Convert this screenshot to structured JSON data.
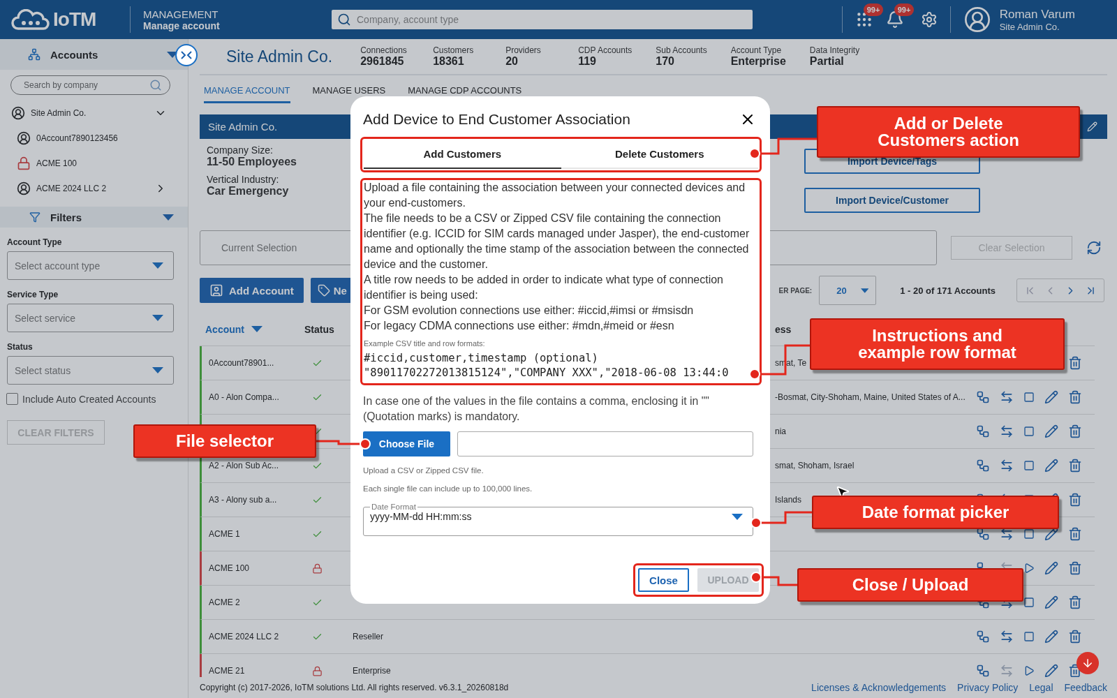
{
  "header": {
    "logo": "IoTM",
    "section": "MANAGEMENT",
    "subsection": "Manage account",
    "search": {
      "placeholder": "Company, account type"
    },
    "badges": [
      "99+",
      "99+"
    ],
    "user": {
      "name": "Roman Varum",
      "company": "Site Admin Co."
    }
  },
  "sidebar": {
    "title": "Accounts",
    "search": {
      "placeholder": "Search by company"
    },
    "tree": [
      {
        "label": "Site Admin Co.",
        "locked": false,
        "expanded": true,
        "children": [
          {
            "label": "0Account7890123456",
            "locked": false
          },
          {
            "label": "ACME 100",
            "locked": true
          },
          {
            "label": "ACME 2024 LLC 2",
            "locked": false,
            "expanded": false
          }
        ]
      }
    ],
    "filters": {
      "title": "Filters",
      "fields": [
        {
          "label": "Account Type",
          "placeholder": "Select account type"
        },
        {
          "label": "Service Type",
          "placeholder": "Select service"
        },
        {
          "label": "Status",
          "placeholder": "Select status"
        }
      ],
      "checkbox": {
        "label": "Include Auto Created Accounts",
        "checked": false
      },
      "clear_button": {
        "label": "CLEAR FILTERS",
        "disabled": true
      }
    }
  },
  "account_header": {
    "title": "Site Admin Co.",
    "stats": [
      {
        "label": "Connections",
        "value": "2961845"
      },
      {
        "label": "Customers",
        "value": "18361"
      },
      {
        "label": "Providers",
        "value": "20"
      },
      {
        "label": "CDP Accounts",
        "value": "119"
      },
      {
        "label": "Sub Accounts",
        "value": "170"
      },
      {
        "label": "Account Type",
        "value": "Enterprise"
      },
      {
        "label": "Data Integrity",
        "value": "Partial"
      }
    ]
  },
  "tabs": [
    {
      "label": "MANAGE ACCOUNT",
      "selected": true
    },
    {
      "label": "MANAGE USERS",
      "selected": false
    },
    {
      "label": "MANAGE CDP ACCOUNTS",
      "selected": false
    }
  ],
  "company_card": {
    "title": "Site Admin Co.",
    "details": [
      {
        "label": "Company Size:",
        "value": "11-50 Employees"
      },
      {
        "label": "Vertical Industry:",
        "value": "Car Emergency"
      }
    ],
    "buttons": [
      "Import Device/Tags",
      "Import Device/Customer"
    ]
  },
  "selection": {
    "placeholder": "Current Selection",
    "clear_button": {
      "label": "Clear Selection",
      "disabled": true
    }
  },
  "toolbar": {
    "buttons": [
      "Add Account",
      "Ne"
    ],
    "per_page_label": "ER PAGE:",
    "per_page": "20",
    "range": "1 - 20 of 171 Accounts",
    "pager": [
      {
        "kind": "first",
        "disabled": true
      },
      {
        "kind": "prev",
        "disabled": true
      },
      {
        "kind": "next",
        "disabled": false
      },
      {
        "kind": "last",
        "disabled": false
      }
    ]
  },
  "table": {
    "columns": [
      "Account",
      "Status",
      "ess"
    ],
    "rows": [
      {
        "account": "0Account78901...",
        "locked": false,
        "address": "smat, Te"
      },
      {
        "account": "A0 - Alon Compa...",
        "locked": false,
        "address": "-Bosmat, City-Shoham, Maine, United States of A..."
      },
      {
        "locked": false,
        "address": "nia"
      },
      {
        "account": "A2 - Alon Sub Ac...",
        "locked": false,
        "address": "smat, Shoham, Israel"
      },
      {
        "account": "A3 - Alony sub a...",
        "locked": false,
        "address": "Islands"
      },
      {
        "account": "ACME 1",
        "locked": false
      },
      {
        "account": "ACME 100",
        "locked": true
      },
      {
        "account": "ACME 2",
        "locked": false
      },
      {
        "account": "ACME 2024 LLC 2",
        "locked": false,
        "type": "Reseller"
      },
      {
        "account": "ACME 21",
        "locked": true,
        "type": "Enterprise"
      }
    ]
  },
  "footer": {
    "copyright": "Copyright (c) 2017-2026, IoTM solutions Ltd. All rights reserved. v6.3.1_20260818d",
    "links": [
      "Licenses & Acknowledgements",
      "Privacy Policy",
      "Legal",
      "Feedback"
    ]
  },
  "dialog": {
    "title": "Add Device to End Customer Association",
    "tabs": [
      {
        "label": "Add Customers",
        "selected": true
      },
      {
        "label": "Delete Customers",
        "selected": false
      }
    ],
    "instructions": [
      "Upload a file containing the association between your connected devices and your end-customers.",
      "The file needs to be a CSV or Zipped CSV file containing the connection identifier (e.g. ICCID for SIM cards managed under Jasper), the end-customer name and optionally the time stamp of the association between the connected device and the customer.",
      "A title row needs to be added in order to indicate what type of connection identifier is being used:",
      "For GSM evolution connections use either: #iccid,#imsi or #msisdn",
      "For legacy CDMA connections use either: #mdn,#meid or #esn"
    ],
    "example_label": "Example CSV title and row formats:",
    "example_lines": [
      "#iccid,customer,timestamp (optional)",
      "\"89011702272013815124\",\"COMPANY XXX\",\"2018-06-08 13:44:0"
    ],
    "note": "In case one of the values in the file contains a comma, enclosing it in \"\" (Quotation marks) is mandatory.",
    "choose_file": "Choose File",
    "hints": [
      "Upload a CSV or Zipped CSV file.",
      "Each single file can include up to 100,000 lines."
    ],
    "date_format": {
      "label": "Date Format",
      "value": "yyyy-MM-dd HH:mm:ss"
    },
    "buttons": [
      {
        "label": "Close",
        "disabled": false
      },
      {
        "label": "UPLOAD",
        "disabled": true
      }
    ]
  },
  "callouts": [
    {
      "text": "Add or Delete Customers action"
    },
    {
      "text": "Instructions and example row format"
    },
    {
      "text": "File selector"
    },
    {
      "text": "Date format picker"
    },
    {
      "text": "Close / Upload"
    }
  ]
}
